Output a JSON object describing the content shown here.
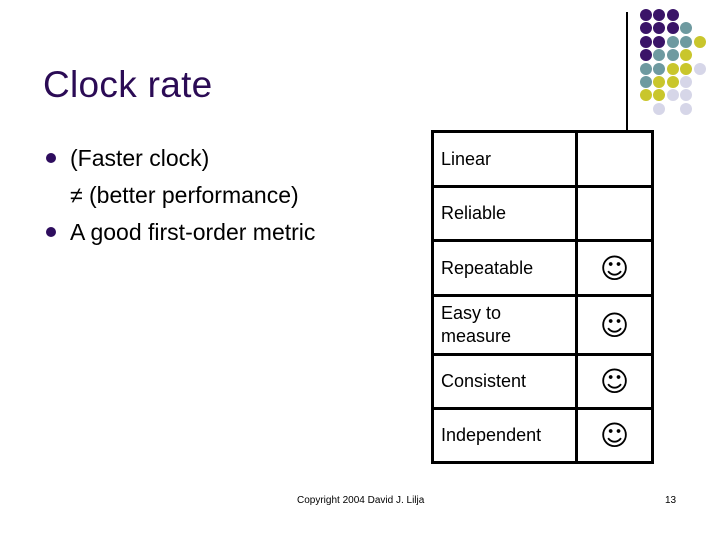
{
  "slide": {
    "title": "Clock rate",
    "bullets": [
      {
        "marker": "bullet",
        "text": "(Faster clock)"
      },
      {
        "marker": "none",
        "text": "≠ (better performance)"
      },
      {
        "marker": "bullet",
        "text": "A good first-order metric"
      }
    ],
    "table": {
      "rows": [
        {
          "label": "Linear",
          "mark": ""
        },
        {
          "label": "Reliable",
          "mark": ""
        },
        {
          "label": "Repeatable",
          "mark": "☺"
        },
        {
          "label": "Easy to measure",
          "mark": "☺"
        },
        {
          "label": "Consistent",
          "mark": "☺"
        },
        {
          "label": "Independent",
          "mark": "☺"
        }
      ]
    },
    "footer": {
      "copyright": "Copyright 2004 David J. Lilja",
      "page_number": "13"
    }
  },
  "decoration": {
    "colors": {
      "P": "#3a1468",
      "T": "#6e9aa0",
      "Y": "#c9c62c",
      "L": "#d6d6e8"
    },
    "dot_grid": [
      "PPP..",
      "PPPT.",
      "PPTTY",
      "PTTY.",
      "TTYYL",
      "TYYL.",
      "YYLL.",
      ".L.L."
    ]
  }
}
